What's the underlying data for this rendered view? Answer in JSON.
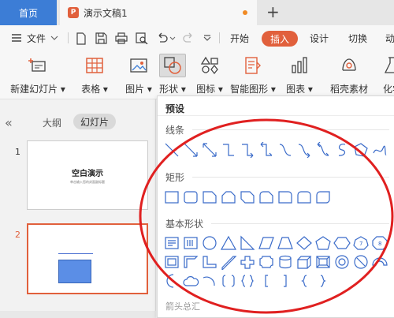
{
  "titlebar": {
    "home_tab": "首页",
    "doc_logo": "P",
    "doc_title": "演示文稿1",
    "new_tab": "+"
  },
  "menubar": {
    "file": "文件",
    "tabs": [
      "开始",
      "插入",
      "设计",
      "切换",
      "动"
    ],
    "active_tab": "插入"
  },
  "ribbon": {
    "buttons": [
      {
        "label": "新建幻灯片",
        "icon": "new-slide-icon"
      },
      {
        "label": "表格",
        "icon": "table-icon"
      },
      {
        "label": "图片",
        "icon": "picture-icon"
      },
      {
        "label": "形状",
        "icon": "shape-icon"
      },
      {
        "label": "图标",
        "icon": "icon-icon"
      },
      {
        "label": "智能图形",
        "icon": "smartart-icon"
      },
      {
        "label": "图表",
        "icon": "chart-icon"
      },
      {
        "label": "稻壳素材",
        "icon": "docer-icon"
      },
      {
        "label": "化学",
        "icon": "chemistry-icon"
      }
    ]
  },
  "leftpane": {
    "outline_label": "大纲",
    "slides_label": "幻灯片",
    "slides": [
      {
        "number": "1",
        "title": "空白演示",
        "subtitle": "单击输入您的封面副标题"
      },
      {
        "number": "2"
      }
    ]
  },
  "shapes_panel": {
    "preset": "预设",
    "categories": {
      "lines": "线条",
      "rectangles": "矩形",
      "basic": "基本形状",
      "arrows": "箭头总汇"
    }
  },
  "colors": {
    "accent": "#e1603c",
    "home_tab": "#3c7dd6",
    "shape_stroke": "#3a6bc9",
    "annotation": "#e02020"
  }
}
